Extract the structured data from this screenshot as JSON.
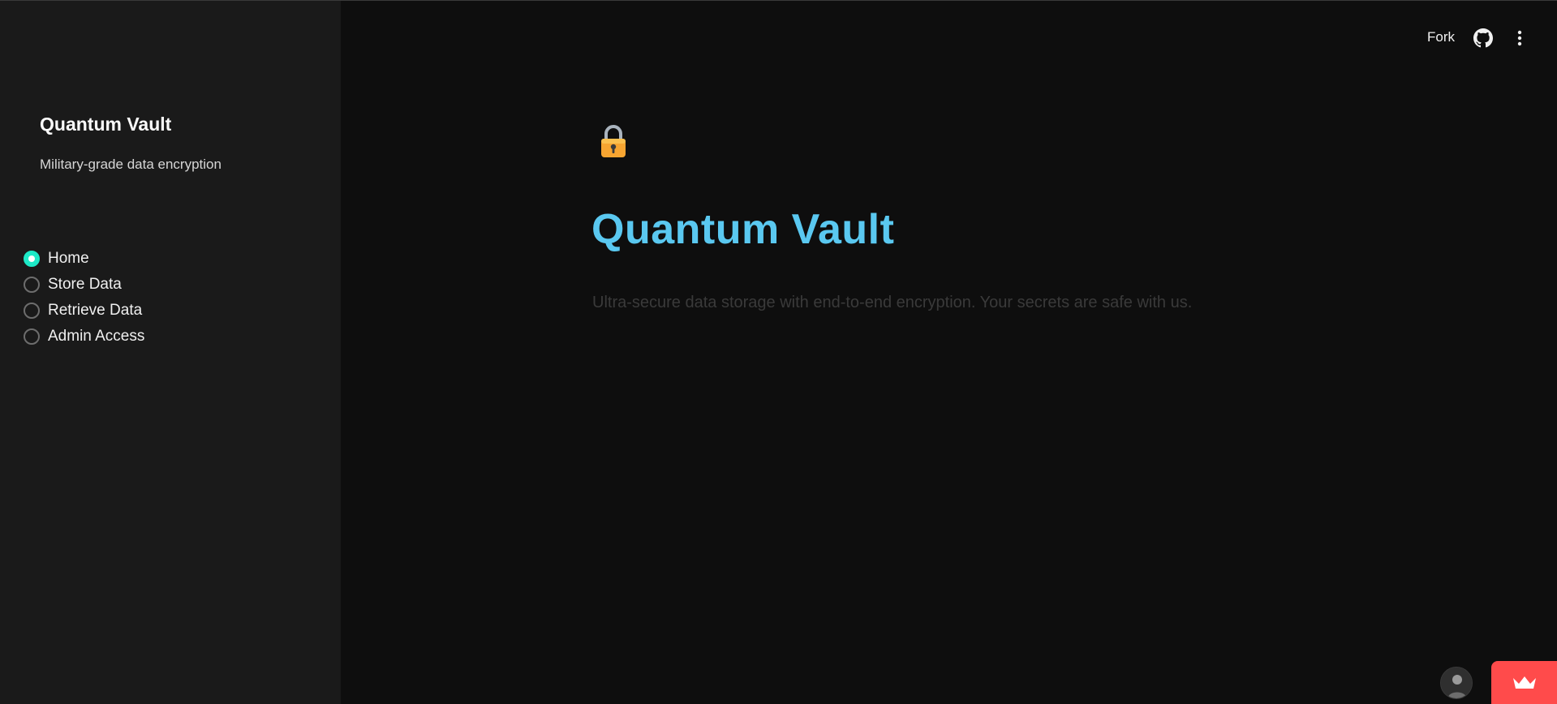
{
  "sidebar": {
    "title": "Quantum Vault",
    "subtitle": "Military-grade data encryption",
    "nav": {
      "selected": "Home",
      "options": [
        {
          "label": "Home",
          "checked": true
        },
        {
          "label": "Store Data",
          "checked": false
        },
        {
          "label": "Retrieve Data",
          "checked": false
        },
        {
          "label": "Admin Access",
          "checked": false
        }
      ]
    }
  },
  "header": {
    "fork_label": "Fork",
    "icons": [
      "github-icon",
      "more-vert-icon"
    ]
  },
  "main": {
    "icon": "lock-icon",
    "title": "Quantum Vault",
    "description": "Ultra-secure data storage with end-to-end encryption. Your secrets are safe with us."
  },
  "footer": {
    "icons": [
      "avatar",
      "crown-icon"
    ]
  },
  "colors": {
    "accent": "#1de9c7",
    "title": "#5ac8f0",
    "sidebar_bg": "#1a1a1a",
    "main_bg": "#0e0e0e",
    "badge": "#ff4b4b"
  }
}
